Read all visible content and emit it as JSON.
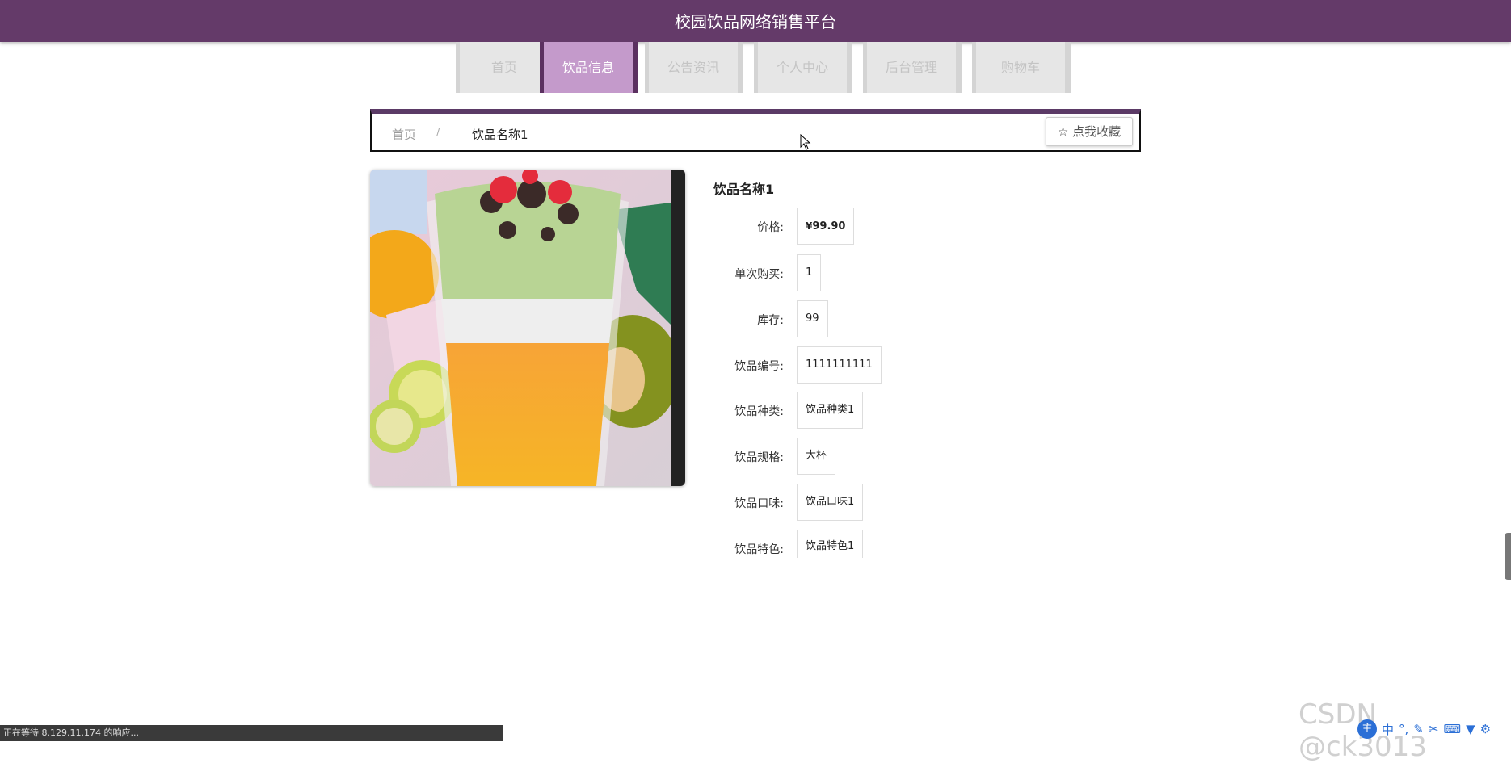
{
  "header": {
    "title": "校园饮品网络销售平台"
  },
  "nav": {
    "items": [
      {
        "label": "首页",
        "active": false
      },
      {
        "label": "饮品信息",
        "active": true
      },
      {
        "label": "公告资讯",
        "active": false
      },
      {
        "label": "个人中心",
        "active": false
      },
      {
        "label": "后台管理",
        "active": false
      },
      {
        "label": "购物车",
        "active": false
      }
    ]
  },
  "breadcrumb": {
    "home": "首页",
    "separator": "/",
    "current": "饮品名称1",
    "favorite_label": "☆ 点我收藏"
  },
  "product": {
    "name": "饮品名称1",
    "price": {
      "label": "价格:",
      "currency": "¥",
      "value": "99.90"
    },
    "fields": [
      {
        "label": "单次购买:",
        "value": "1"
      },
      {
        "label": "库存:",
        "value": "99"
      },
      {
        "label": "饮品编号:",
        "value": "1111111111"
      },
      {
        "label": "饮品种类:",
        "value": "饮品种类1"
      },
      {
        "label": "饮品规格:",
        "value": "大杯"
      },
      {
        "label": "饮品口味:",
        "value": "饮品口味1"
      },
      {
        "label": "饮品特色:",
        "value": "饮品特色1"
      }
    ]
  },
  "status": {
    "text": "正在等待 8.129.11.174 的响应..."
  },
  "watermark": "CSDN @ck3013",
  "ime": {
    "logo": "主",
    "mode": "中"
  },
  "colors": {
    "brand": "#643a69",
    "nav_active": "#c49acb",
    "price": "#c4282b"
  }
}
